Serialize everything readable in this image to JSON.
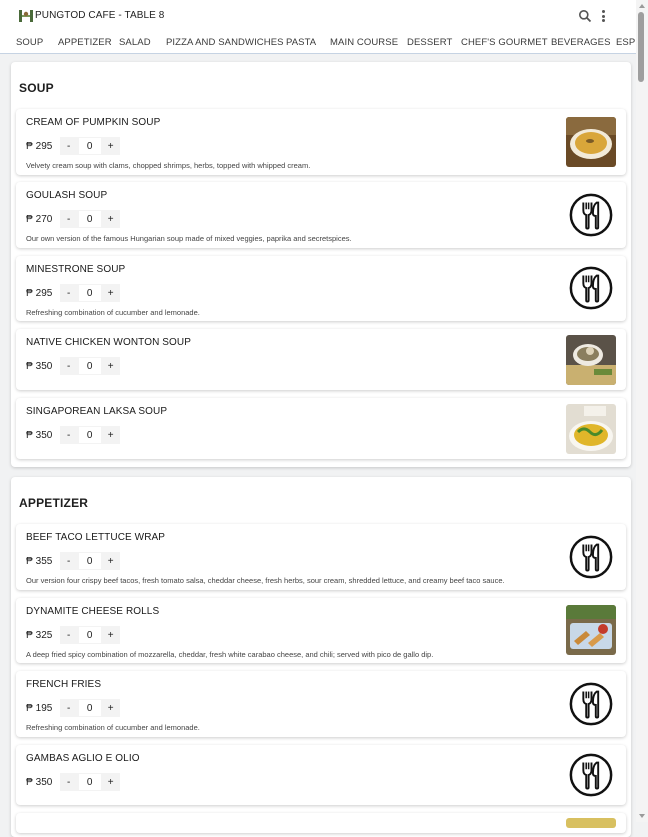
{
  "header": {
    "title": "PUNGTOD CAFE - TABLE 8",
    "logo_icon": "cafe-logo-icon",
    "search_icon": "search-icon",
    "more_icon": "more-vertical-icon"
  },
  "tabs": [
    "SOUP",
    "APPETIZER",
    "SALAD",
    "PIZZA AND SANDWICHES",
    "PASTA",
    "MAIN COURSE",
    "DESSERT",
    "CHEF'S GOURMET",
    "BEVERAGES",
    "ESPR"
  ],
  "currency": "₱",
  "sections": [
    {
      "title": "SOUP",
      "items": [
        {
          "name": "CREAM OF PUMPKIN SOUP",
          "price": "295",
          "qty": "0",
          "description": "Velvety cream soup with clams, chopped shrimps, herbs, topped with whipped cream.",
          "image": "pumpkin-soup-photo"
        },
        {
          "name": "GOULASH SOUP",
          "price": "270",
          "qty": "0",
          "description": "Our own version of the famous Hungarian soup made of mixed veggies, paprika and secretspices.",
          "image": "utensils-placeholder-icon"
        },
        {
          "name": "MINESTRONE SOUP",
          "price": "295",
          "qty": "0",
          "description": "Refreshing combination of cucumber and lemonade.",
          "image": "utensils-placeholder-icon"
        },
        {
          "name": "NATIVE CHICKEN WONTON SOUP",
          "price": "350",
          "qty": "0",
          "description": "",
          "image": "wonton-soup-photo"
        },
        {
          "name": "SINGAPOREAN LAKSA SOUP",
          "price": "350",
          "qty": "0",
          "description": "",
          "image": "laksa-soup-photo"
        }
      ]
    },
    {
      "title": "APPETIZER",
      "items": [
        {
          "name": "BEEF TACO LETTUCE WRAP",
          "price": "355",
          "qty": "0",
          "description": "Our version four crispy beef tacos, fresh tomato salsa, cheddar cheese, fresh herbs, sour cream, shredded lettuce, and creamy beef taco sauce.",
          "image": "utensils-placeholder-icon"
        },
        {
          "name": "DYNAMITE CHEESE ROLLS",
          "price": "325",
          "qty": "0",
          "description": "A deep fried spicy combination of mozzarella, cheddar, fresh white carabao cheese, and chili; served with pico de gallo dip.",
          "image": "cheese-rolls-photo"
        },
        {
          "name": "FRENCH FRIES",
          "price": "195",
          "qty": "0",
          "description": "Refreshing combination of cucumber and lemonade.",
          "image": "utensils-placeholder-icon"
        },
        {
          "name": "GAMBAS AGLIO E OLIO",
          "price": "350",
          "qty": "0",
          "description": "",
          "image": "utensils-placeholder-icon"
        }
      ]
    }
  ],
  "qty_minus_label": "-",
  "qty_plus_label": "+"
}
